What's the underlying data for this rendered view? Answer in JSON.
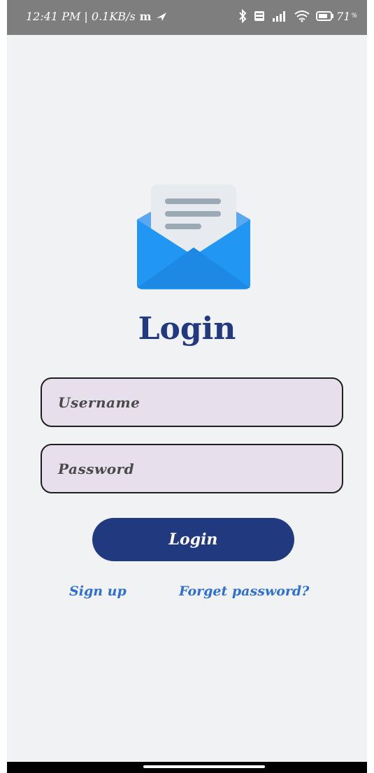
{
  "status_bar": {
    "time_speed": "12:41 PM | 0.1KB/s",
    "carrier_glyph": "m",
    "battery_level": "71",
    "battery_percent_sign": "%",
    "icons": [
      "bluetooth-icon",
      "volte-icon",
      "signal-icon",
      "wifi-icon",
      "battery-icon",
      "location-arrow-icon"
    ]
  },
  "login": {
    "title": "Login",
    "username_placeholder": "Username",
    "password_placeholder": "Password",
    "button_label": "Login",
    "signup_link": "Sign up",
    "forgot_link": "Forget password?"
  },
  "colors": {
    "primary": "#213a7f",
    "link": "#2f6fd1",
    "field_bg": "#e8dfec",
    "envelope_blue": "#2196f3",
    "background": "#f1f2f4"
  }
}
